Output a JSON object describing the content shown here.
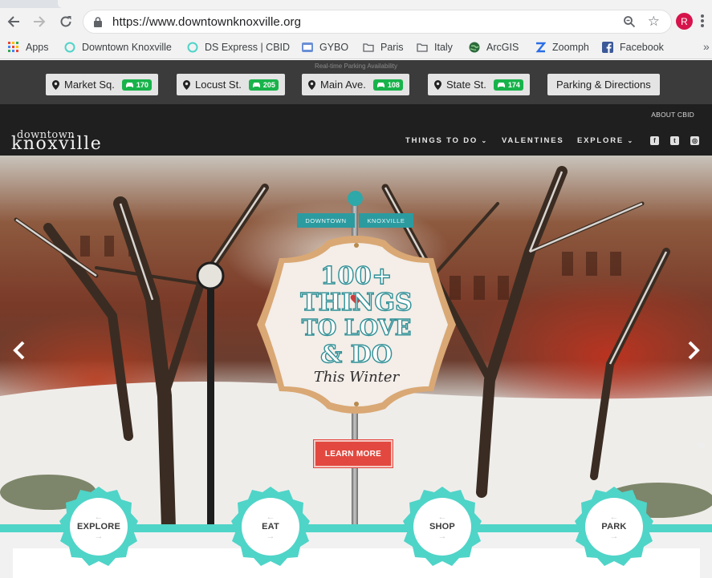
{
  "browser": {
    "url": "https://www.downtownknoxville.org",
    "profile_initial": "R",
    "bookmarks": [
      "Apps",
      "Downtown Knoxville",
      "DS Express | CBID",
      "GYBO",
      "Paris",
      "Italy",
      "ArcGIS",
      "Zoomph",
      "Facebook"
    ],
    "more": "»"
  },
  "parking": {
    "caption": "Real-time Parking Availability",
    "lots": [
      {
        "name": "Market Sq.",
        "count": "170"
      },
      {
        "name": "Locust St.",
        "count": "205"
      },
      {
        "name": "Main Ave.",
        "count": "108"
      },
      {
        "name": "State St.",
        "count": "174"
      }
    ],
    "directions_label": "Parking & Directions",
    "badge_color": "#18b34b"
  },
  "header": {
    "about": "ABOUT CBID",
    "logo_top": "downtown",
    "logo_main": "knoxville",
    "nav": [
      "THINGS TO DO",
      "VALENTINES",
      "EXPLORE"
    ],
    "social": [
      "facebook-icon",
      "twitter-icon",
      "instagram-icon"
    ]
  },
  "hero": {
    "street_left": "DOWNTOWN",
    "street_right": "KNOXVILLE",
    "line1": "100+",
    "line2": "THINGS",
    "line3": "TO LOVE",
    "line4": "& DO",
    "line5": "This Winter",
    "cta": "LEARN MORE",
    "accent": "#2f8f95"
  },
  "quicklinks": [
    {
      "label": "EXPLORE"
    },
    {
      "label": "EAT"
    },
    {
      "label": "SHOP"
    },
    {
      "label": "PARK"
    }
  ],
  "ribbon_color": "#4fd4c8"
}
